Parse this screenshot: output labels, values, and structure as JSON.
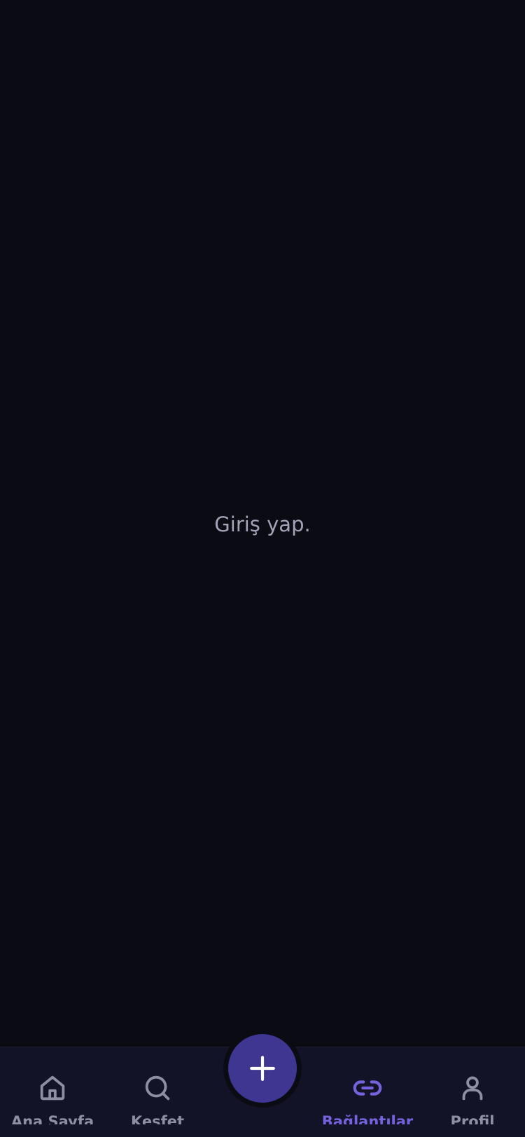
{
  "main": {
    "empty_message": "Giriş yap."
  },
  "tabbar": {
    "active_tab": "Bağlantılar",
    "items": [
      {
        "label": "Ana Sayfa",
        "icon": "home-icon"
      },
      {
        "label": "Keşfet",
        "icon": "search-icon"
      },
      {
        "label": "Bağlantılar",
        "icon": "link-icon"
      },
      {
        "label": "Profil",
        "icon": "user-icon"
      }
    ],
    "fab_icon": "plus-icon"
  },
  "colors": {
    "background": "#0b0b14",
    "tabbar": "#131327",
    "inactive": "#8f8fa4",
    "active": "#7563de",
    "fab": "#3f3691",
    "message": "#a3a3b8"
  }
}
